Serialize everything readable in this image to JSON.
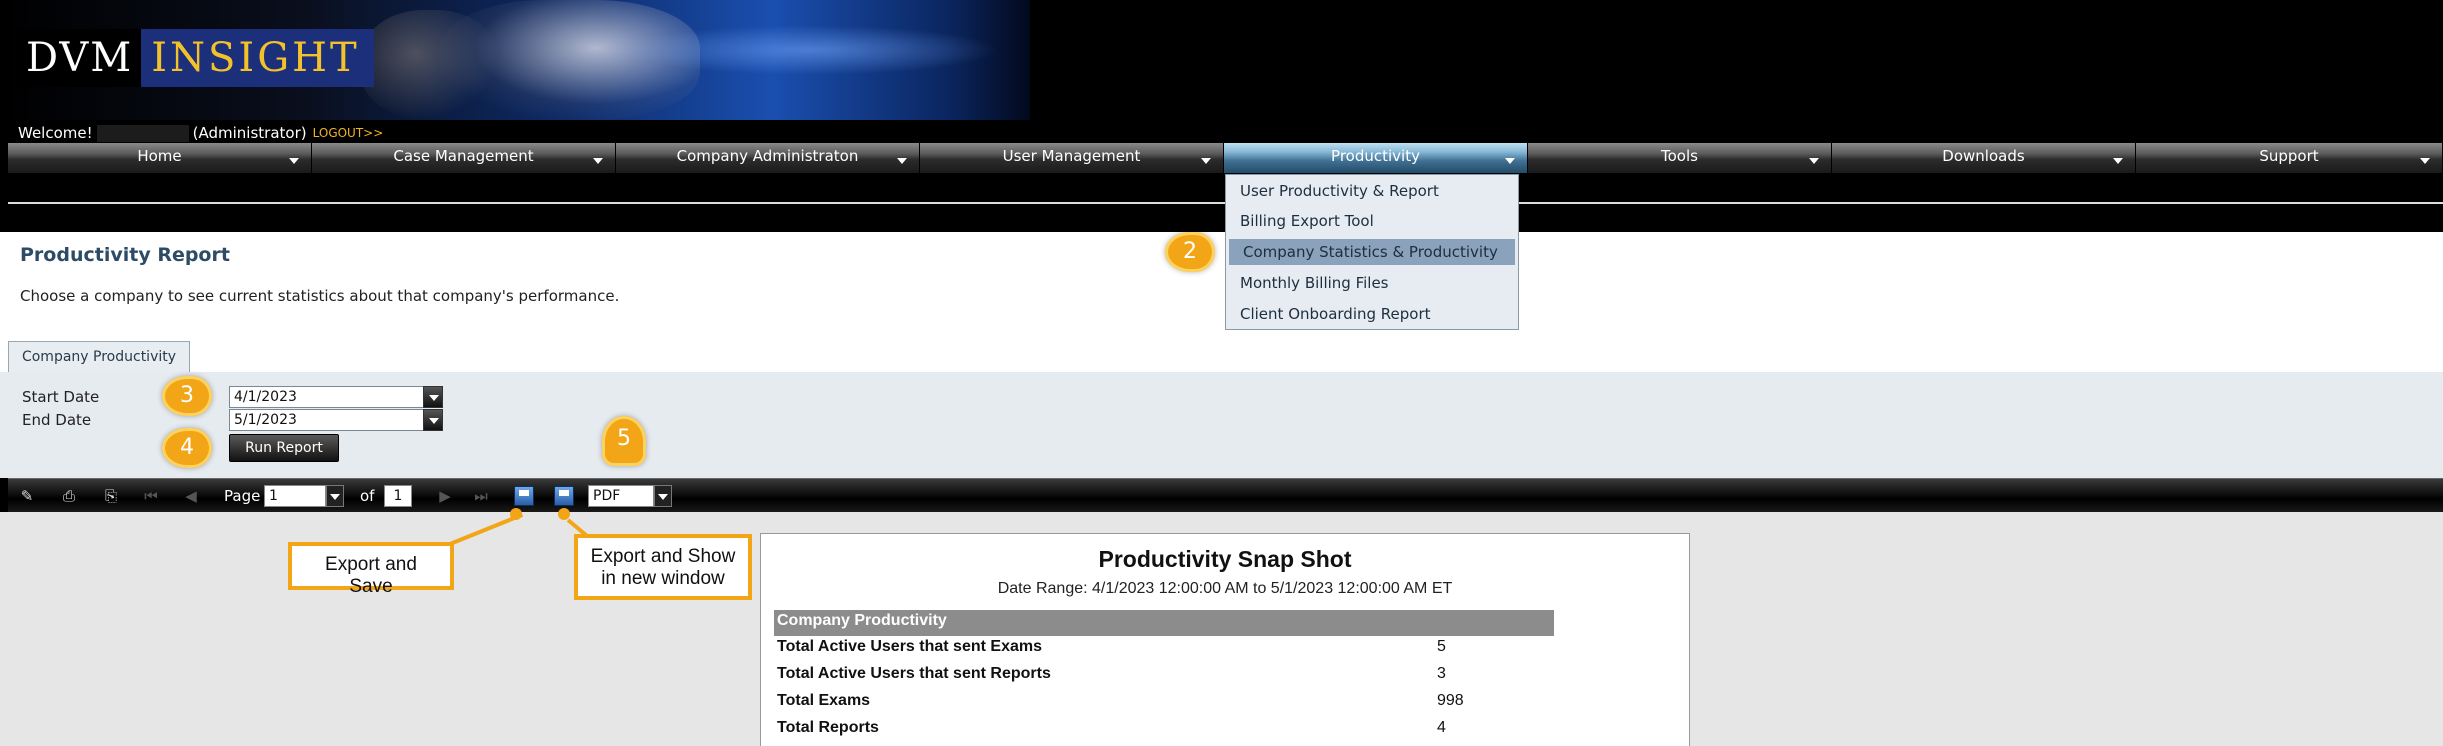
{
  "brand": {
    "logo_left": "DVM",
    "logo_right": "INSIGHT"
  },
  "welcome": {
    "greeting": "Welcome!",
    "role": "(Administrator)",
    "logout": "LOGOUT>>"
  },
  "nav": {
    "items": [
      {
        "label": "Home"
      },
      {
        "label": "Case Management"
      },
      {
        "label": "Company Administraton"
      },
      {
        "label": "User Management"
      },
      {
        "label": "Productivity"
      },
      {
        "label": "Tools"
      },
      {
        "label": "Downloads"
      },
      {
        "label": "Support"
      }
    ]
  },
  "dropdown": {
    "items": [
      {
        "label": "User Productivity & Report"
      },
      {
        "label": "Billing Export Tool"
      },
      {
        "label": "Company Statistics & Productivity"
      },
      {
        "label": "Monthly Billing Files"
      },
      {
        "label": "Client Onboarding Report"
      }
    ]
  },
  "report": {
    "title": "Productivity Report",
    "description": "Choose a company to see current statistics about that company's performance.",
    "tab": "Company Productivity",
    "start_label": "Start Date",
    "start_value": "4/1/2023",
    "end_label": "End Date",
    "end_value": "5/1/2023",
    "run_label": "Run Report"
  },
  "toolbar": {
    "page_label": "Page",
    "page_value": "1",
    "of_label": "of",
    "total_pages": "1",
    "format": "PDF"
  },
  "snapshot": {
    "title": "Productivity Snap Shot",
    "range": "Date Range: 4/1/2023 12:00:00 AM to 5/1/2023 12:00:00 AM ET",
    "section": "Company Productivity",
    "rows": [
      {
        "label": "Total Active Users that sent Exams",
        "value": "5"
      },
      {
        "label": "Total Active Users that sent Reports",
        "value": "3"
      },
      {
        "label": "Total Exams",
        "value": "998"
      },
      {
        "label": "Total Reports",
        "value": "4"
      }
    ]
  },
  "callouts": {
    "step2": "2",
    "step3": "3",
    "step4": "4",
    "step5": "5",
    "export_save": "Export and Save",
    "export_show_1": "Export and Show",
    "export_show_2": "in new window"
  },
  "colors": {
    "accent": "#f2a517",
    "nav_active": "#86b7d6",
    "title": "#2e4b66"
  }
}
